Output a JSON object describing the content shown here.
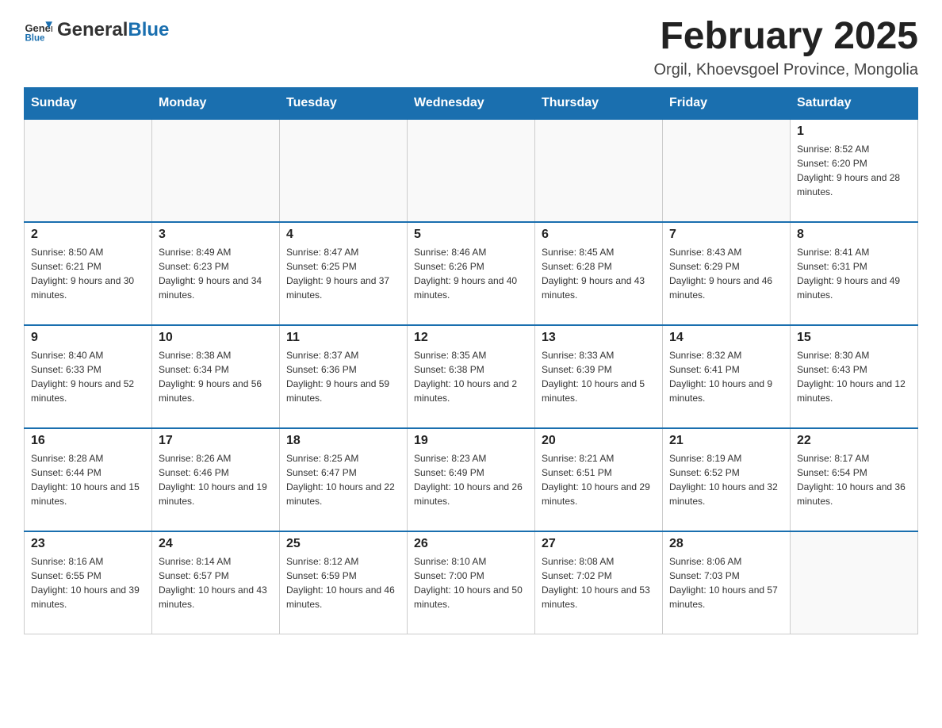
{
  "header": {
    "logo": {
      "general": "General",
      "blue": "Blue"
    },
    "title": "February 2025",
    "subtitle": "Orgil, Khoevsgoel Province, Mongolia"
  },
  "days_of_week": [
    "Sunday",
    "Monday",
    "Tuesday",
    "Wednesday",
    "Thursday",
    "Friday",
    "Saturday"
  ],
  "weeks": [
    [
      {
        "day": "",
        "info": ""
      },
      {
        "day": "",
        "info": ""
      },
      {
        "day": "",
        "info": ""
      },
      {
        "day": "",
        "info": ""
      },
      {
        "day": "",
        "info": ""
      },
      {
        "day": "",
        "info": ""
      },
      {
        "day": "1",
        "info": "Sunrise: 8:52 AM\nSunset: 6:20 PM\nDaylight: 9 hours and 28 minutes."
      }
    ],
    [
      {
        "day": "2",
        "info": "Sunrise: 8:50 AM\nSunset: 6:21 PM\nDaylight: 9 hours and 30 minutes."
      },
      {
        "day": "3",
        "info": "Sunrise: 8:49 AM\nSunset: 6:23 PM\nDaylight: 9 hours and 34 minutes."
      },
      {
        "day": "4",
        "info": "Sunrise: 8:47 AM\nSunset: 6:25 PM\nDaylight: 9 hours and 37 minutes."
      },
      {
        "day": "5",
        "info": "Sunrise: 8:46 AM\nSunset: 6:26 PM\nDaylight: 9 hours and 40 minutes."
      },
      {
        "day": "6",
        "info": "Sunrise: 8:45 AM\nSunset: 6:28 PM\nDaylight: 9 hours and 43 minutes."
      },
      {
        "day": "7",
        "info": "Sunrise: 8:43 AM\nSunset: 6:29 PM\nDaylight: 9 hours and 46 minutes."
      },
      {
        "day": "8",
        "info": "Sunrise: 8:41 AM\nSunset: 6:31 PM\nDaylight: 9 hours and 49 minutes."
      }
    ],
    [
      {
        "day": "9",
        "info": "Sunrise: 8:40 AM\nSunset: 6:33 PM\nDaylight: 9 hours and 52 minutes."
      },
      {
        "day": "10",
        "info": "Sunrise: 8:38 AM\nSunset: 6:34 PM\nDaylight: 9 hours and 56 minutes."
      },
      {
        "day": "11",
        "info": "Sunrise: 8:37 AM\nSunset: 6:36 PM\nDaylight: 9 hours and 59 minutes."
      },
      {
        "day": "12",
        "info": "Sunrise: 8:35 AM\nSunset: 6:38 PM\nDaylight: 10 hours and 2 minutes."
      },
      {
        "day": "13",
        "info": "Sunrise: 8:33 AM\nSunset: 6:39 PM\nDaylight: 10 hours and 5 minutes."
      },
      {
        "day": "14",
        "info": "Sunrise: 8:32 AM\nSunset: 6:41 PM\nDaylight: 10 hours and 9 minutes."
      },
      {
        "day": "15",
        "info": "Sunrise: 8:30 AM\nSunset: 6:43 PM\nDaylight: 10 hours and 12 minutes."
      }
    ],
    [
      {
        "day": "16",
        "info": "Sunrise: 8:28 AM\nSunset: 6:44 PM\nDaylight: 10 hours and 15 minutes."
      },
      {
        "day": "17",
        "info": "Sunrise: 8:26 AM\nSunset: 6:46 PM\nDaylight: 10 hours and 19 minutes."
      },
      {
        "day": "18",
        "info": "Sunrise: 8:25 AM\nSunset: 6:47 PM\nDaylight: 10 hours and 22 minutes."
      },
      {
        "day": "19",
        "info": "Sunrise: 8:23 AM\nSunset: 6:49 PM\nDaylight: 10 hours and 26 minutes."
      },
      {
        "day": "20",
        "info": "Sunrise: 8:21 AM\nSunset: 6:51 PM\nDaylight: 10 hours and 29 minutes."
      },
      {
        "day": "21",
        "info": "Sunrise: 8:19 AM\nSunset: 6:52 PM\nDaylight: 10 hours and 32 minutes."
      },
      {
        "day": "22",
        "info": "Sunrise: 8:17 AM\nSunset: 6:54 PM\nDaylight: 10 hours and 36 minutes."
      }
    ],
    [
      {
        "day": "23",
        "info": "Sunrise: 8:16 AM\nSunset: 6:55 PM\nDaylight: 10 hours and 39 minutes."
      },
      {
        "day": "24",
        "info": "Sunrise: 8:14 AM\nSunset: 6:57 PM\nDaylight: 10 hours and 43 minutes."
      },
      {
        "day": "25",
        "info": "Sunrise: 8:12 AM\nSunset: 6:59 PM\nDaylight: 10 hours and 46 minutes."
      },
      {
        "day": "26",
        "info": "Sunrise: 8:10 AM\nSunset: 7:00 PM\nDaylight: 10 hours and 50 minutes."
      },
      {
        "day": "27",
        "info": "Sunrise: 8:08 AM\nSunset: 7:02 PM\nDaylight: 10 hours and 53 minutes."
      },
      {
        "day": "28",
        "info": "Sunrise: 8:06 AM\nSunset: 7:03 PM\nDaylight: 10 hours and 57 minutes."
      },
      {
        "day": "",
        "info": ""
      }
    ]
  ]
}
